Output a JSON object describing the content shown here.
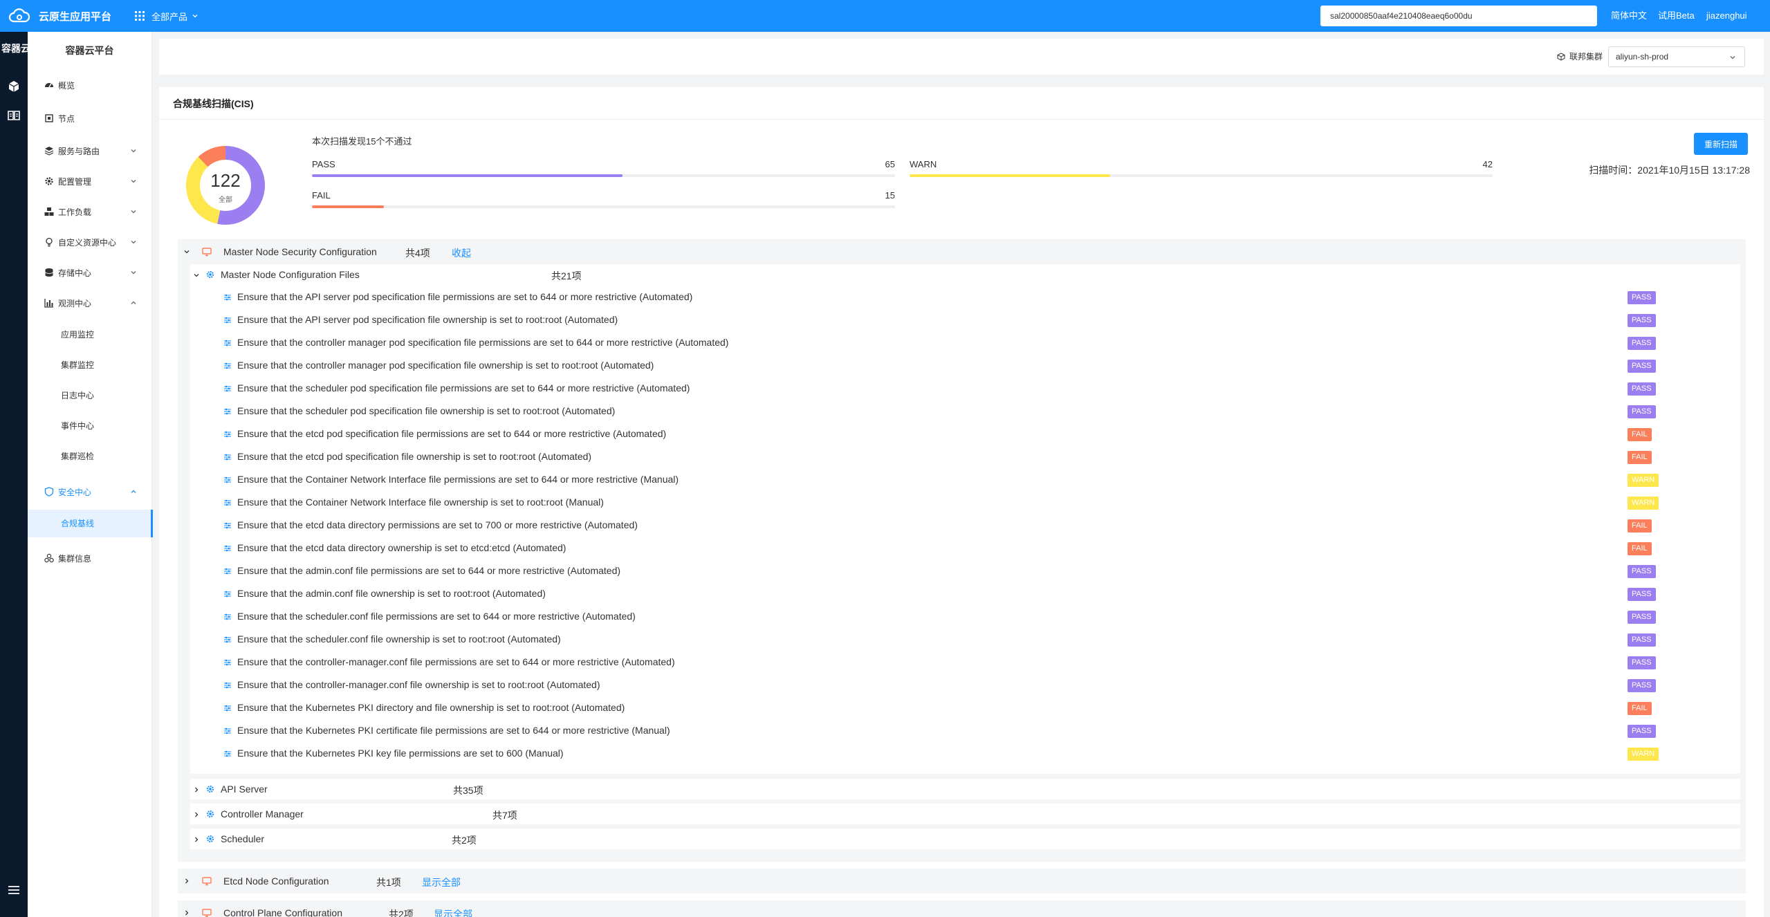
{
  "topbar": {
    "brand": "云原生应用平台",
    "products_label": "全部产品",
    "search_value": "sal20000850aaf4e210408eaeq6o00du",
    "lang": "简体中文",
    "trial": "试用Beta",
    "user": "jiazenghui"
  },
  "rail": {
    "title": "容器云"
  },
  "sidebar": {
    "title": "容器云平台",
    "items": [
      {
        "label": "概览"
      },
      {
        "label": "节点"
      },
      {
        "label": "服务与路由"
      },
      {
        "label": "配置管理"
      },
      {
        "label": "工作负载"
      },
      {
        "label": "自定义资源中心"
      },
      {
        "label": "存储中心"
      },
      {
        "label": "观测中心"
      },
      {
        "label": "安全中心"
      },
      {
        "label": "集群信息"
      }
    ],
    "observe_sub": [
      "应用监控",
      "集群监控",
      "日志中心",
      "事件中心",
      "集群巡检"
    ],
    "security_sub": [
      "合规基线"
    ]
  },
  "filter": {
    "federated_label": "联邦集群",
    "cluster_value": "aliyun-sh-prod"
  },
  "card": {
    "title": "合规基线扫描(CIS)",
    "summary": "本次扫描发现15个不通过",
    "rescan_label": "重新扫描",
    "scan_time": "扫描时间：2021年10月15日 13:17:28",
    "total": "122",
    "total_sub": "全部"
  },
  "stats": {
    "pass": {
      "label": "PASS",
      "value": 65,
      "color": "#9b7ff0"
    },
    "warn": {
      "label": "WARN",
      "value": 42,
      "color": "#fde74c"
    },
    "fail": {
      "label": "FAIL",
      "value": 15,
      "color": "#fb7f5a"
    }
  },
  "groups": {
    "master": {
      "title": "Master Node Security Configuration",
      "count": "共4项",
      "action": "收起"
    },
    "etcd": {
      "title": "Etcd Node Configuration",
      "count": "共1项",
      "action": "显示全部"
    },
    "control": {
      "title": "Control Plane Configuration",
      "count": "共2项",
      "action": "显示全部"
    }
  },
  "subgroups": {
    "files": {
      "title": "Master Node Configuration Files",
      "count": "共21项"
    },
    "api": {
      "title": "API Server",
      "count": "共35项"
    },
    "cm": {
      "title": "Controller Manager",
      "count": "共7项"
    },
    "sched": {
      "title": "Scheduler",
      "count": "共2项"
    }
  },
  "checks": [
    {
      "text": "Ensure that the API server pod specification file permissions are set to 644 or more restrictive (Automated)",
      "status": "PASS"
    },
    {
      "text": "Ensure that the API server pod specification file ownership is set to root:root (Automated)",
      "status": "PASS"
    },
    {
      "text": "Ensure that the controller manager pod specification file permissions are set to 644 or more restrictive (Automated)",
      "status": "PASS"
    },
    {
      "text": "Ensure that the controller manager pod specification file ownership is set to root:root (Automated)",
      "status": "PASS"
    },
    {
      "text": "Ensure that the scheduler pod specification file permissions are set to 644 or more restrictive (Automated)",
      "status": "PASS"
    },
    {
      "text": "Ensure that the scheduler pod specification file ownership is set to root:root (Automated)",
      "status": "PASS"
    },
    {
      "text": "Ensure that the etcd pod specification file permissions are set to 644 or more restrictive (Automated)",
      "status": "FAIL"
    },
    {
      "text": "Ensure that the etcd pod specification file ownership is set to root:root (Automated)",
      "status": "FAIL"
    },
    {
      "text": "Ensure that the Container Network Interface file permissions are set to 644 or more restrictive (Manual)",
      "status": "WARN"
    },
    {
      "text": "Ensure that the Container Network Interface file ownership is set to root:root (Manual)",
      "status": "WARN"
    },
    {
      "text": "Ensure that the etcd data directory permissions are set to 700 or more restrictive (Automated)",
      "status": "FAIL"
    },
    {
      "text": "Ensure that the etcd data directory ownership is set to etcd:etcd (Automated)",
      "status": "FAIL"
    },
    {
      "text": "Ensure that the admin.conf file permissions are set to 644 or more restrictive (Automated)",
      "status": "PASS"
    },
    {
      "text": "Ensure that the admin.conf file ownership is set to root:root (Automated)",
      "status": "PASS"
    },
    {
      "text": "Ensure that the scheduler.conf file permissions are set to 644 or more restrictive (Automated)",
      "status": "PASS"
    },
    {
      "text": "Ensure that the scheduler.conf file ownership is set to root:root (Automated)",
      "status": "PASS"
    },
    {
      "text": "Ensure that the controller-manager.conf file permissions are set to 644 or more restrictive (Automated)",
      "status": "PASS"
    },
    {
      "text": "Ensure that the controller-manager.conf file ownership is set to root:root (Automated)",
      "status": "PASS"
    },
    {
      "text": "Ensure that the Kubernetes PKI directory and file ownership is set to root:root (Automated)",
      "status": "FAIL"
    },
    {
      "text": "Ensure that the Kubernetes PKI certificate file permissions are set to 644 or more restrictive (Manual)",
      "status": "PASS"
    },
    {
      "text": "Ensure that the Kubernetes PKI key file permissions are set to 600 (Manual)",
      "status": "WARN"
    }
  ]
}
